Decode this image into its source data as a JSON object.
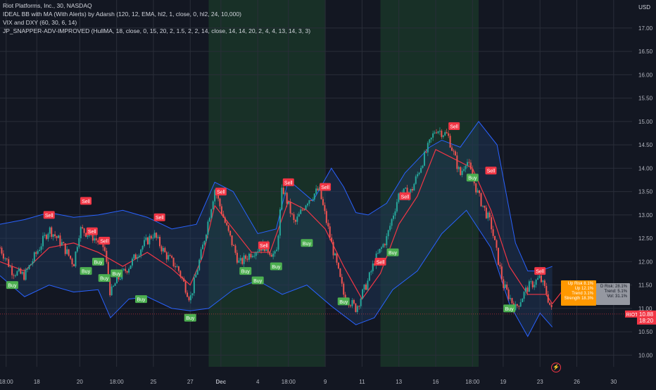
{
  "legend": {
    "symbol": "Riot Platforms, Inc., 30, NASDAQ",
    "indicator1": "IDEAL BB with MA (With Alerts) by Adarsh (120, 12, EMA, hl2, 1, close, 0, hl2, 24, 10,000)",
    "indicator2": "VIX and DXY (60, 30, 6, 14)",
    "indicator3": "JP_SNAPPER-ADV-IMPROVED (HullMA, 18, close, 0, 15, 20, 2, 1.5, 2, 2, 14, close, 14, 14, 20, 2, 4, 4, 13, 14, 3, 3)"
  },
  "currency": "USD",
  "info_boxes": {
    "orange": [
      "Up Risk 8.1%",
      "Up 12.1%",
      "Trend 3.1%",
      "Strength 18.3%"
    ],
    "grey": [
      "D Risk: 28.1%",
      "Trend: 5.1%",
      "Vol: 31.1%"
    ]
  },
  "event_icon": "lightning-icon",
  "colors": {
    "background": "#131722",
    "up_candle": "#26a69a",
    "down_candle": "#ef5350",
    "band_line": "#2962ff",
    "band_fill": "#1e3a5f",
    "ma_line": "#f23645",
    "buy_label": "#4caf50",
    "sell_label": "#f23645",
    "session_highlight": "#1b3a2a",
    "current_price_line": "#f23645"
  },
  "chart_data": {
    "type": "candlestick",
    "title": "Riot Platforms, Inc., 30, NASDAQ",
    "ylim": [
      9.75,
      17.6
    ],
    "y_ticks": [
      "10.00",
      "10.50",
      "11.00",
      "11.50",
      "12.00",
      "12.50",
      "13.00",
      "13.50",
      "14.00",
      "14.50",
      "15.00",
      "15.50",
      "16.00",
      "16.50",
      "17.00"
    ],
    "x_ticks": [
      "18:00",
      "18",
      "20",
      "18:00",
      "25",
      "27",
      "Dec",
      "4",
      "18:00",
      "9",
      "11",
      "13",
      "16",
      "18:00",
      "19",
      "23",
      "26",
      "30"
    ],
    "x_tick_index": [
      1,
      6,
      13,
      19,
      25,
      31,
      36,
      42,
      47,
      53,
      59,
      65,
      71,
      77,
      82,
      88,
      94,
      100
    ],
    "x_range": [
      0,
      103
    ],
    "highlight_ranges": [
      [
        34,
        53
      ],
      [
        62,
        78
      ]
    ],
    "price_path": [
      [
        0,
        12.3
      ],
      [
        2,
        11.8
      ],
      [
        4,
        11.7
      ],
      [
        6,
        12.2
      ],
      [
        8,
        12.7
      ],
      [
        10,
        12.4
      ],
      [
        12,
        11.95
      ],
      [
        13,
        12.7
      ],
      [
        15,
        12.55
      ],
      [
        17,
        12.3
      ],
      [
        18,
        11.3
      ],
      [
        19,
        11.6
      ],
      [
        21,
        11.9
      ],
      [
        23,
        12.3
      ],
      [
        25,
        12.6
      ],
      [
        27,
        12.15
      ],
      [
        29,
        11.85
      ],
      [
        31,
        11.2
      ],
      [
        33,
        12.3
      ],
      [
        35,
        13.55
      ],
      [
        37,
        12.7
      ],
      [
        39,
        11.95
      ],
      [
        41,
        12.2
      ],
      [
        43,
        12.35
      ],
      [
        45,
        12.1
      ],
      [
        46,
        13.6
      ],
      [
        48,
        12.8
      ],
      [
        50,
        13.3
      ],
      [
        52,
        13.55
      ],
      [
        54,
        12.4
      ],
      [
        56,
        11.3
      ],
      [
        58,
        11.0
      ],
      [
        60,
        11.6
      ],
      [
        61,
        12.0
      ],
      [
        63,
        12.5
      ],
      [
        65,
        13.45
      ],
      [
        67,
        13.5
      ],
      [
        69,
        14.2
      ],
      [
        71,
        14.85
      ],
      [
        73,
        14.7
      ],
      [
        75,
        13.85
      ],
      [
        76,
        14.2
      ],
      [
        78,
        13.4
      ],
      [
        80,
        12.8
      ],
      [
        82,
        11.5
      ],
      [
        84,
        11.0
      ],
      [
        86,
        11.45
      ],
      [
        88,
        11.65
      ],
      [
        89,
        11.35
      ],
      [
        90,
        10.9
      ]
    ],
    "bb_upper": [
      [
        0,
        12.8
      ],
      [
        4,
        12.9
      ],
      [
        8,
        13.05
      ],
      [
        12,
        12.95
      ],
      [
        16,
        13.0
      ],
      [
        20,
        13.1
      ],
      [
        24,
        12.95
      ],
      [
        28,
        12.7
      ],
      [
        32,
        12.8
      ],
      [
        35,
        13.7
      ],
      [
        38,
        13.5
      ],
      [
        42,
        12.6
      ],
      [
        45,
        12.7
      ],
      [
        47,
        13.75
      ],
      [
        51,
        13.3
      ],
      [
        54,
        14.0
      ],
      [
        56,
        13.6
      ],
      [
        58,
        13.05
      ],
      [
        60,
        13.0
      ],
      [
        63,
        13.25
      ],
      [
        66,
        13.9
      ],
      [
        70,
        14.45
      ],
      [
        72,
        14.6
      ],
      [
        75,
        14.45
      ],
      [
        78,
        15.0
      ],
      [
        81,
        14.5
      ],
      [
        84,
        12.4
      ],
      [
        86,
        11.8
      ],
      [
        88,
        11.8
      ],
      [
        90,
        11.9
      ]
    ],
    "bb_lower": [
      [
        0,
        11.7
      ],
      [
        4,
        11.25
      ],
      [
        8,
        11.5
      ],
      [
        12,
        11.35
      ],
      [
        16,
        11.4
      ],
      [
        18,
        10.8
      ],
      [
        21,
        11.2
      ],
      [
        24,
        11.25
      ],
      [
        28,
        11.0
      ],
      [
        31,
        10.95
      ],
      [
        34,
        11.0
      ],
      [
        38,
        11.4
      ],
      [
        42,
        11.6
      ],
      [
        46,
        11.3
      ],
      [
        50,
        11.5
      ],
      [
        54,
        11.05
      ],
      [
        58,
        10.65
      ],
      [
        61,
        10.8
      ],
      [
        64,
        11.4
      ],
      [
        68,
        11.8
      ],
      [
        72,
        12.6
      ],
      [
        76,
        13.1
      ],
      [
        80,
        12.3
      ],
      [
        83,
        11.1
      ],
      [
        86,
        10.4
      ],
      [
        88,
        10.9
      ],
      [
        90,
        10.6
      ]
    ],
    "ma": [
      [
        0,
        12.0
      ],
      [
        4,
        11.8
      ],
      [
        8,
        12.3
      ],
      [
        12,
        12.4
      ],
      [
        16,
        12.2
      ],
      [
        20,
        11.9
      ],
      [
        24,
        12.2
      ],
      [
        28,
        11.85
      ],
      [
        31,
        11.5
      ],
      [
        33,
        12.1
      ],
      [
        35,
        13.2
      ],
      [
        38,
        12.7
      ],
      [
        41,
        12.2
      ],
      [
        44,
        12.2
      ],
      [
        47,
        13.3
      ],
      [
        50,
        13.1
      ],
      [
        53,
        12.7
      ],
      [
        56,
        11.9
      ],
      [
        59,
        11.2
      ],
      [
        62,
        11.75
      ],
      [
        65,
        12.8
      ],
      [
        68,
        13.4
      ],
      [
        71,
        14.4
      ],
      [
        74,
        14.2
      ],
      [
        77,
        14.0
      ],
      [
        80,
        13.1
      ],
      [
        83,
        11.9
      ],
      [
        86,
        11.3
      ],
      [
        89,
        11.3
      ],
      [
        90,
        11.1
      ],
      [
        93,
        11.6
      ]
    ],
    "signals": [
      {
        "type": "Buy",
        "x": 2,
        "y": 11.5
      },
      {
        "type": "Sell",
        "x": 8,
        "y": 13.0
      },
      {
        "type": "Sell",
        "x": 14,
        "y": 13.3
      },
      {
        "type": "Buy",
        "x": 14,
        "y": 11.8
      },
      {
        "type": "Sell",
        "x": 15,
        "y": 12.65
      },
      {
        "type": "Sell",
        "x": 17,
        "y": 12.45
      },
      {
        "type": "Buy",
        "x": 16,
        "y": 12.0
      },
      {
        "type": "Buy",
        "x": 17,
        "y": 11.65
      },
      {
        "type": "Buy",
        "x": 19,
        "y": 11.75
      },
      {
        "type": "Sell",
        "x": 26,
        "y": 12.95
      },
      {
        "type": "Buy",
        "x": 23,
        "y": 11.2
      },
      {
        "type": "Buy",
        "x": 31,
        "y": 10.8
      },
      {
        "type": "Sell",
        "x": 36,
        "y": 13.5
      },
      {
        "type": "Buy",
        "x": 40,
        "y": 11.8
      },
      {
        "type": "Buy",
        "x": 42,
        "y": 11.6
      },
      {
        "type": "Sell",
        "x": 43,
        "y": 12.35
      },
      {
        "type": "Buy",
        "x": 45,
        "y": 11.9
      },
      {
        "type": "Sell",
        "x": 47,
        "y": 13.7
      },
      {
        "type": "Buy",
        "x": 50,
        "y": 12.4
      },
      {
        "type": "Sell",
        "x": 53,
        "y": 13.6
      },
      {
        "type": "Buy",
        "x": 56,
        "y": 11.15
      },
      {
        "type": "Sell",
        "x": 62,
        "y": 12.0
      },
      {
        "type": "Buy",
        "x": 64,
        "y": 12.2
      },
      {
        "type": "Sell",
        "x": 66,
        "y": 13.4
      },
      {
        "type": "Sell",
        "x": 74,
        "y": 14.9
      },
      {
        "type": "Buy",
        "x": 77,
        "y": 13.8
      },
      {
        "type": "Sell",
        "x": 80,
        "y": 13.95
      },
      {
        "type": "Buy",
        "x": 83,
        "y": 11.0
      },
      {
        "type": "Sell",
        "x": 88,
        "y": 11.8
      }
    ],
    "current_price": {
      "symbol": "RIOT",
      "price": "10.88",
      "countdown": "18:20"
    }
  }
}
